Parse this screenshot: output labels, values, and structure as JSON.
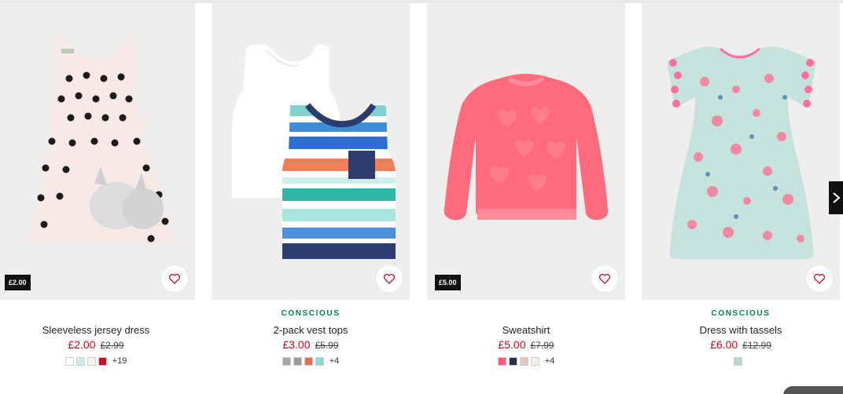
{
  "products": [
    {
      "conscious": "",
      "name": "Sleeveless jersey dress",
      "price": "£2.00",
      "old_price": "£2.99",
      "price_tag": "£2.00",
      "swatches": [
        "#ffffff",
        "#cfeee9",
        "#f2f2e6",
        "#c8102e"
      ],
      "more": "+19"
    },
    {
      "conscious": "CONSCIOUS",
      "name": "2-pack vest tops",
      "price": "£3.00",
      "old_price": "£5.99",
      "price_tag": "",
      "swatches": [
        "#a6a6a6",
        "#9a9a9a",
        "#e0705a",
        "#8fd8d8"
      ],
      "more": "+4"
    },
    {
      "conscious": "",
      "name": "Sweatshirt",
      "price": "£5.00",
      "old_price": "£7.99",
      "price_tag": "£5.00",
      "swatches": [
        "#ff5a76",
        "#27304f",
        "#e0c8c8",
        "#f2f0e4"
      ],
      "more": "+4"
    },
    {
      "conscious": "CONSCIOUS",
      "name": "Dress with tassels",
      "price": "£6.00",
      "old_price": "£12.99",
      "price_tag": "",
      "swatches": [
        "#b8d6cc"
      ],
      "more": ""
    }
  ],
  "colors": {
    "sale_red": "#d0021b",
    "conscious_green": "#0a7a55",
    "heart": "#c8102e"
  },
  "icons": {
    "favorite": "heart-icon",
    "next": "chevron-right-icon"
  }
}
